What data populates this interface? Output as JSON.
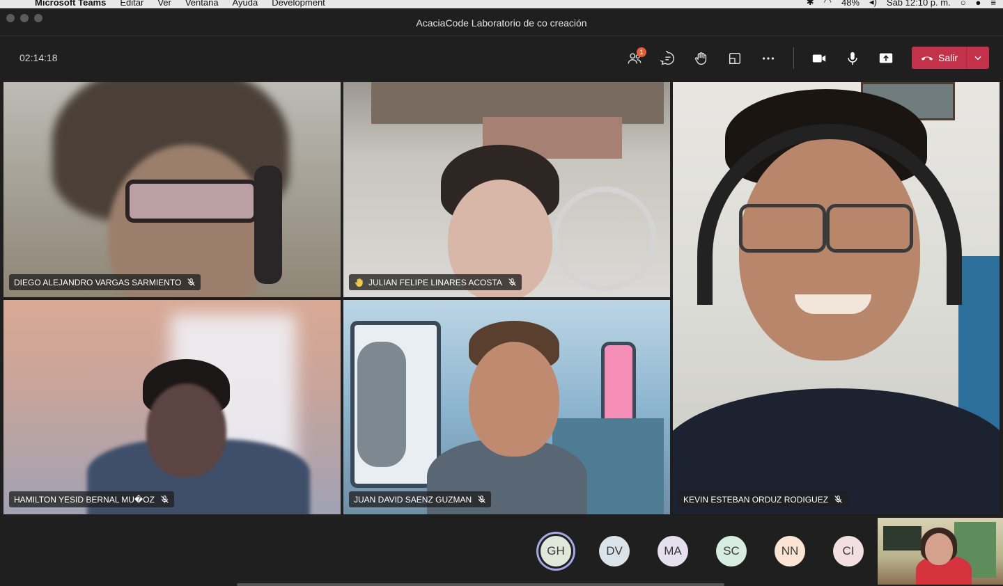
{
  "menubar": {
    "app": "Microsoft Teams",
    "items": [
      "Editar",
      "Ver",
      "Ventana",
      "Ayuda",
      "Development"
    ],
    "battery": "48%",
    "clock": "Sáb 12:10 p. m."
  },
  "window": {
    "title": "AcaciaCode Laboratorio de co creación"
  },
  "toolbar": {
    "timer": "02:14:18",
    "participants_badge": "1",
    "leave_label": "Salir"
  },
  "participants": [
    {
      "name": "DIEGO ALEJANDRO VARGAS SARMIENTO",
      "muted": true,
      "hand_raised": false
    },
    {
      "name": "JULIAN FELIPE LINARES ACOSTA",
      "muted": true,
      "hand_raised": true
    },
    {
      "name": "KEVIN ESTEBAN ORDUZ RODIGUEZ",
      "muted": true,
      "hand_raised": false
    },
    {
      "name": "HAMILTON YESID BERNAL MU�OZ",
      "muted": true,
      "hand_raised": false
    },
    {
      "name": "JUAN DAVID SAENZ GUZMAN",
      "muted": true,
      "hand_raised": false
    }
  ],
  "avatars": [
    {
      "initials": "GH",
      "color": "#dfe8da",
      "speaking": true
    },
    {
      "initials": "DV",
      "color": "#dbe3ea",
      "speaking": false
    },
    {
      "initials": "MA",
      "color": "#e6dfee",
      "speaking": false
    },
    {
      "initials": "SC",
      "color": "#d6ece3",
      "speaking": false
    },
    {
      "initials": "NN",
      "color": "#fbe4d4",
      "speaking": false
    },
    {
      "initials": "CI",
      "color": "#f3dfe2",
      "speaking": false
    }
  ],
  "colors": {
    "leave_red": "#c4314b",
    "speaking_ring": "#a5a8e6",
    "badge": "#e2613b"
  }
}
